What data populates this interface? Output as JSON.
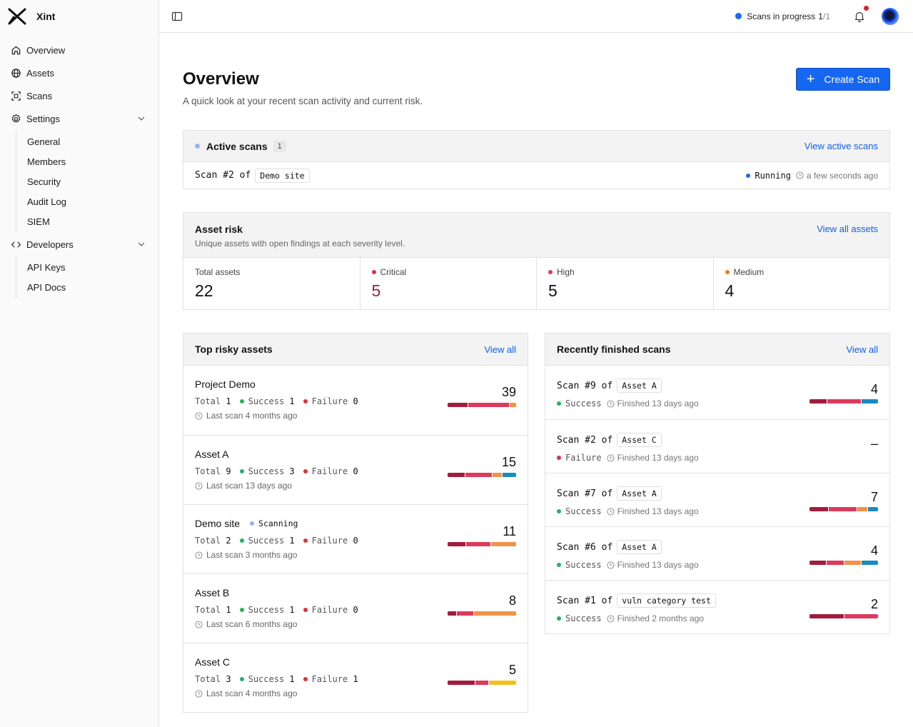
{
  "brand": {
    "name": "Xint"
  },
  "sidebar": {
    "items": [
      {
        "label": "Overview",
        "icon": "home-icon"
      },
      {
        "label": "Assets",
        "icon": "globe-icon"
      },
      {
        "label": "Scans",
        "icon": "scan-icon"
      },
      {
        "label": "Settings",
        "icon": "gear-icon"
      },
      {
        "label": "Developers",
        "icon": "code-icon"
      }
    ],
    "settings_sub": [
      "General",
      "Members",
      "Security",
      "Audit Log",
      "SIEM"
    ],
    "developers_sub": [
      "API Keys",
      "API Docs"
    ]
  },
  "topbar": {
    "scans_label": "Scans in progress",
    "scans_count": "1",
    "scans_total": "/1"
  },
  "page": {
    "title": "Overview",
    "subtitle": "A quick look at your recent scan activity and current risk.",
    "create_label": "Create Scan"
  },
  "active": {
    "title": "Active scans",
    "count": "1",
    "link": "View active scans",
    "scan_prefix": "Scan #2 of",
    "scan_target": "Demo site",
    "status": "Running",
    "time": "a few seconds ago"
  },
  "risk": {
    "title": "Asset risk",
    "desc": "Unique assets with open findings at each severity level.",
    "link": "View all assets",
    "stats": [
      {
        "label": "Total assets",
        "value": "22"
      },
      {
        "label": "Critical",
        "value": "5"
      },
      {
        "label": "High",
        "value": "5"
      },
      {
        "label": "Medium",
        "value": "4"
      }
    ]
  },
  "labels": {
    "total": "Total",
    "success": "Success",
    "failure": "Failure",
    "scanning": "Scanning",
    "view_all": "View all"
  },
  "top_assets": {
    "title": "Top risky assets",
    "rows": [
      {
        "name": "Project Demo",
        "total": "1",
        "success": "1",
        "failure": "0",
        "last": "Last scan 4 months ago",
        "score": "39",
        "scanning": false
      },
      {
        "name": "Asset A",
        "total": "9",
        "success": "3",
        "failure": "0",
        "last": "Last scan 13 days ago",
        "score": "15",
        "scanning": false
      },
      {
        "name": "Demo site",
        "total": "2",
        "success": "1",
        "failure": "0",
        "last": "Last scan 3 months ago",
        "score": "11",
        "scanning": true
      },
      {
        "name": "Asset B",
        "total": "1",
        "success": "1",
        "failure": "0",
        "last": "Last scan 6 months ago",
        "score": "8",
        "scanning": false
      },
      {
        "name": "Asset C",
        "total": "3",
        "success": "1",
        "failure": "1",
        "last": "Last scan 4 months ago",
        "score": "5",
        "scanning": false
      }
    ]
  },
  "recent_scans": {
    "title": "Recently finished scans",
    "rows": [
      {
        "prefix": "Scan #9 of",
        "target": "Asset A",
        "status": "Success",
        "finished": "Finished 13 days ago",
        "count": "4"
      },
      {
        "prefix": "Scan #2 of",
        "target": "Asset C",
        "status": "Failure",
        "finished": "Finished 13 days ago",
        "count": "–"
      },
      {
        "prefix": "Scan #7 of",
        "target": "Asset A",
        "status": "Success",
        "finished": "Finished 13 days ago",
        "count": "7"
      },
      {
        "prefix": "Scan #6 of",
        "target": "Asset A",
        "status": "Success",
        "finished": "Finished 13 days ago",
        "count": "4"
      },
      {
        "prefix": "Scan #1 of",
        "target": "vuln category test",
        "status": "Success",
        "finished": "Finished 2 months ago",
        "count": "2"
      }
    ]
  },
  "colors": {
    "critical": "#a31c3d",
    "high": "#dc3a5c",
    "medium": "#f0924a",
    "low": "#1a8ac2",
    "info": "#f2c01e",
    "success": "#22b35e",
    "failure": "#e0303c",
    "accent": "#1566f0"
  },
  "severity_bars": {
    "assets": [
      [
        0.3,
        0.6,
        0.1,
        0,
        0
      ],
      [
        0.26,
        0.4,
        0.14,
        0.2,
        0
      ],
      [
        0.27,
        0.36,
        0.37,
        0,
        0
      ],
      [
        0.13,
        0.24,
        0.63,
        0,
        0
      ],
      [
        0.4,
        0.2,
        0,
        0,
        0.4
      ]
    ],
    "scans": [
      [
        0.25,
        0.5,
        0,
        0.25,
        0
      ],
      [
        0,
        0,
        0,
        0,
        0
      ],
      [
        0.28,
        0.42,
        0.15,
        0.15,
        0
      ],
      [
        0.25,
        0.25,
        0.25,
        0.25,
        0
      ],
      [
        0.5,
        0.5,
        0,
        0,
        0
      ]
    ]
  }
}
